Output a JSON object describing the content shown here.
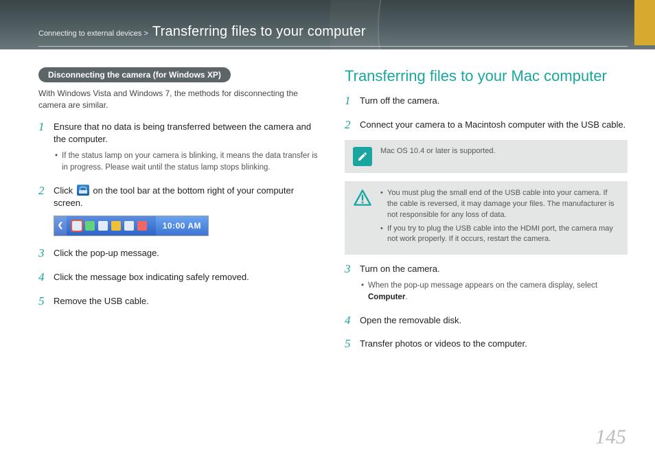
{
  "header": {
    "breadcrumb_prefix": "Connecting to external devices >",
    "breadcrumb_title": "Transferring files to your computer"
  },
  "left": {
    "pill": "Disconnecting the camera (for Windows XP)",
    "intro": "With Windows Vista and Windows 7, the methods for disconnecting the camera are similar.",
    "step1": {
      "text": "Ensure that no data is being transferred between the camera and the computer.",
      "bullet": "If the status lamp on your camera is blinking, it means the data transfer is in progress. Please wait until the status lamp stops blinking."
    },
    "step2": {
      "pre": "Click",
      "post": "on the tool bar at the bottom right of your computer screen.",
      "taskbar_time": "10:00 AM"
    },
    "step3": "Click the pop-up message.",
    "step4": "Click the message box indicating safely removed.",
    "step5": "Remove the USB cable."
  },
  "right": {
    "title": "Transferring files to your Mac computer",
    "step1": "Turn off the camera.",
    "step2": "Connect your camera to a Macintosh computer with the USB cable.",
    "info_note": "Mac OS 10.4 or later is supported.",
    "warn_notes": [
      "You must plug the small end of the USB cable into your camera. If the cable is reversed, it may damage your files. The manufacturer is not responsible for any loss of data.",
      "If you try to plug the USB cable into the HDMI port, the camera may not work properly. If it occurs, restart the camera."
    ],
    "step3": {
      "text": "Turn on the camera.",
      "bullet_pre": "When the pop-up message appears on the camera display, select ",
      "bullet_bold": "Computer",
      "bullet_post": "."
    },
    "step4": "Open the removable disk.",
    "step5": "Transfer photos or videos to the computer."
  },
  "page_number": "145"
}
